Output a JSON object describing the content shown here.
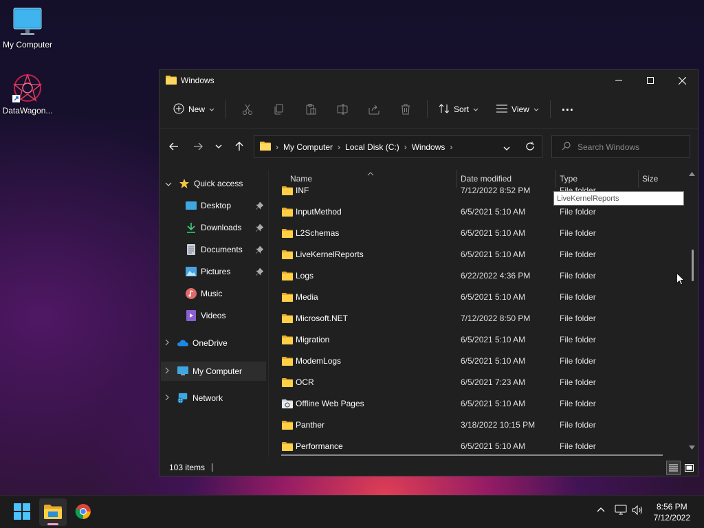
{
  "desktop": {
    "icons": [
      {
        "label": "My Computer"
      },
      {
        "label": "DataWagon..."
      }
    ]
  },
  "window": {
    "title": "Windows",
    "toolbar": {
      "new_label": "New",
      "sort_label": "Sort",
      "view_label": "View",
      "more_label": "..."
    },
    "address": {
      "crumbs": [
        "My Computer",
        "Local Disk (C:)",
        "Windows"
      ]
    },
    "search": {
      "placeholder": "Search Windows"
    },
    "sidebar": {
      "quick_access": "Quick access",
      "items": [
        {
          "label": "Desktop"
        },
        {
          "label": "Downloads"
        },
        {
          "label": "Documents"
        },
        {
          "label": "Pictures"
        },
        {
          "label": "Music"
        },
        {
          "label": "Videos"
        }
      ],
      "onedrive": "OneDrive",
      "my_computer": "My Computer",
      "network": "Network"
    },
    "columns": {
      "name": "Name",
      "date": "Date modified",
      "type": "Type",
      "size": "Size"
    },
    "rows": [
      {
        "name": "INF",
        "date": "7/12/2022 8:52 PM",
        "type": "File folder"
      },
      {
        "name": "InputMethod",
        "date": "6/5/2021 5:10 AM",
        "type": "File folder"
      },
      {
        "name": "L2Schemas",
        "date": "6/5/2021 5:10 AM",
        "type": "File folder"
      },
      {
        "name": "LiveKernelReports",
        "date": "6/5/2021 5:10 AM",
        "type": "File folder"
      },
      {
        "name": "Logs",
        "date": "6/22/2022 4:36 PM",
        "type": "File folder"
      },
      {
        "name": "Media",
        "date": "6/5/2021 5:10 AM",
        "type": "File folder"
      },
      {
        "name": "Microsoft.NET",
        "date": "7/12/2022 8:50 PM",
        "type": "File folder"
      },
      {
        "name": "Migration",
        "date": "6/5/2021 5:10 AM",
        "type": "File folder"
      },
      {
        "name": "ModemLogs",
        "date": "6/5/2021 5:10 AM",
        "type": "File folder"
      },
      {
        "name": "OCR",
        "date": "6/5/2021 7:23 AM",
        "type": "File folder"
      },
      {
        "name": "Offline Web Pages",
        "date": "6/5/2021 5:10 AM",
        "type": "File folder"
      },
      {
        "name": "Panther",
        "date": "3/18/2022 10:15 PM",
        "type": "File folder"
      },
      {
        "name": "Performance",
        "date": "6/5/2021 5:10 AM",
        "type": "File folder"
      }
    ],
    "tooltip": "LiveKernelReports",
    "status": {
      "count": "103 items"
    }
  },
  "taskbar": {
    "time": "8:56 PM",
    "date": "7/12/2022"
  },
  "colors": {
    "folder": "#f3c545",
    "accent": "#4cc2ff",
    "window_bg": "#202020",
    "taskbar_bg": "#1c1c1c"
  }
}
